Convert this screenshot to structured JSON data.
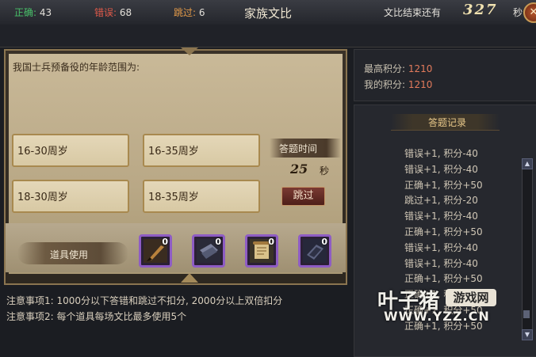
{
  "title": "家族文比",
  "close_icon": "close-icon",
  "stats": {
    "correct_label": "正确:",
    "correct_value": "43",
    "correct_color": "#49c26a",
    "wrong_label": "错误:",
    "wrong_value": "68",
    "wrong_color": "#e05a4a",
    "skip_label": "跳过:",
    "skip_value": "6",
    "skip_color": "#e59b48"
  },
  "timer": {
    "label": "文比结束还有",
    "value": "327",
    "unit": "秒"
  },
  "question": "我国士兵预备役的年龄范围为:",
  "answers": [
    "16-30周岁",
    "16-35周岁",
    "18-30周岁",
    "18-35周岁"
  ],
  "answer_time": {
    "label": "答题时间",
    "value": "25",
    "unit": "秒"
  },
  "skip_button": "跳过",
  "items": {
    "label": "道具使用",
    "slots": [
      {
        "icon": "brush-icon",
        "count": "0"
      },
      {
        "icon": "scroll-bundle-icon",
        "count": "0"
      },
      {
        "icon": "paper-scroll-icon",
        "count": "0"
      },
      {
        "icon": "ink-stone-icon",
        "count": "0"
      }
    ]
  },
  "notes": [
    "注意事项1: 1000分以下答错和跳过不扣分, 2000分以上双倍扣分",
    "注意事项2: 每个道具每场文比最多使用5个"
  ],
  "scores": {
    "highest_label": "最高积分:",
    "highest_value": "1210",
    "mine_label": "我的积分:",
    "mine_value": "1210"
  },
  "record_title": "答题记录",
  "records": [
    "错误+1, 积分-40",
    "错误+1, 积分-40",
    "正确+1, 积分+50",
    "跳过+1, 积分-20",
    "错误+1, 积分-40",
    "正确+1, 积分+50",
    "错误+1, 积分-40",
    "错误+1, 积分-40",
    "正确+1, 积分+50",
    "正确+1, 积分+50",
    "正确+1, 积分+50",
    "正确+1, 积分+50"
  ],
  "watermark": {
    "main": "叶子猪",
    "badge": "游戏网",
    "url": "WWW.YZZ.CN"
  }
}
